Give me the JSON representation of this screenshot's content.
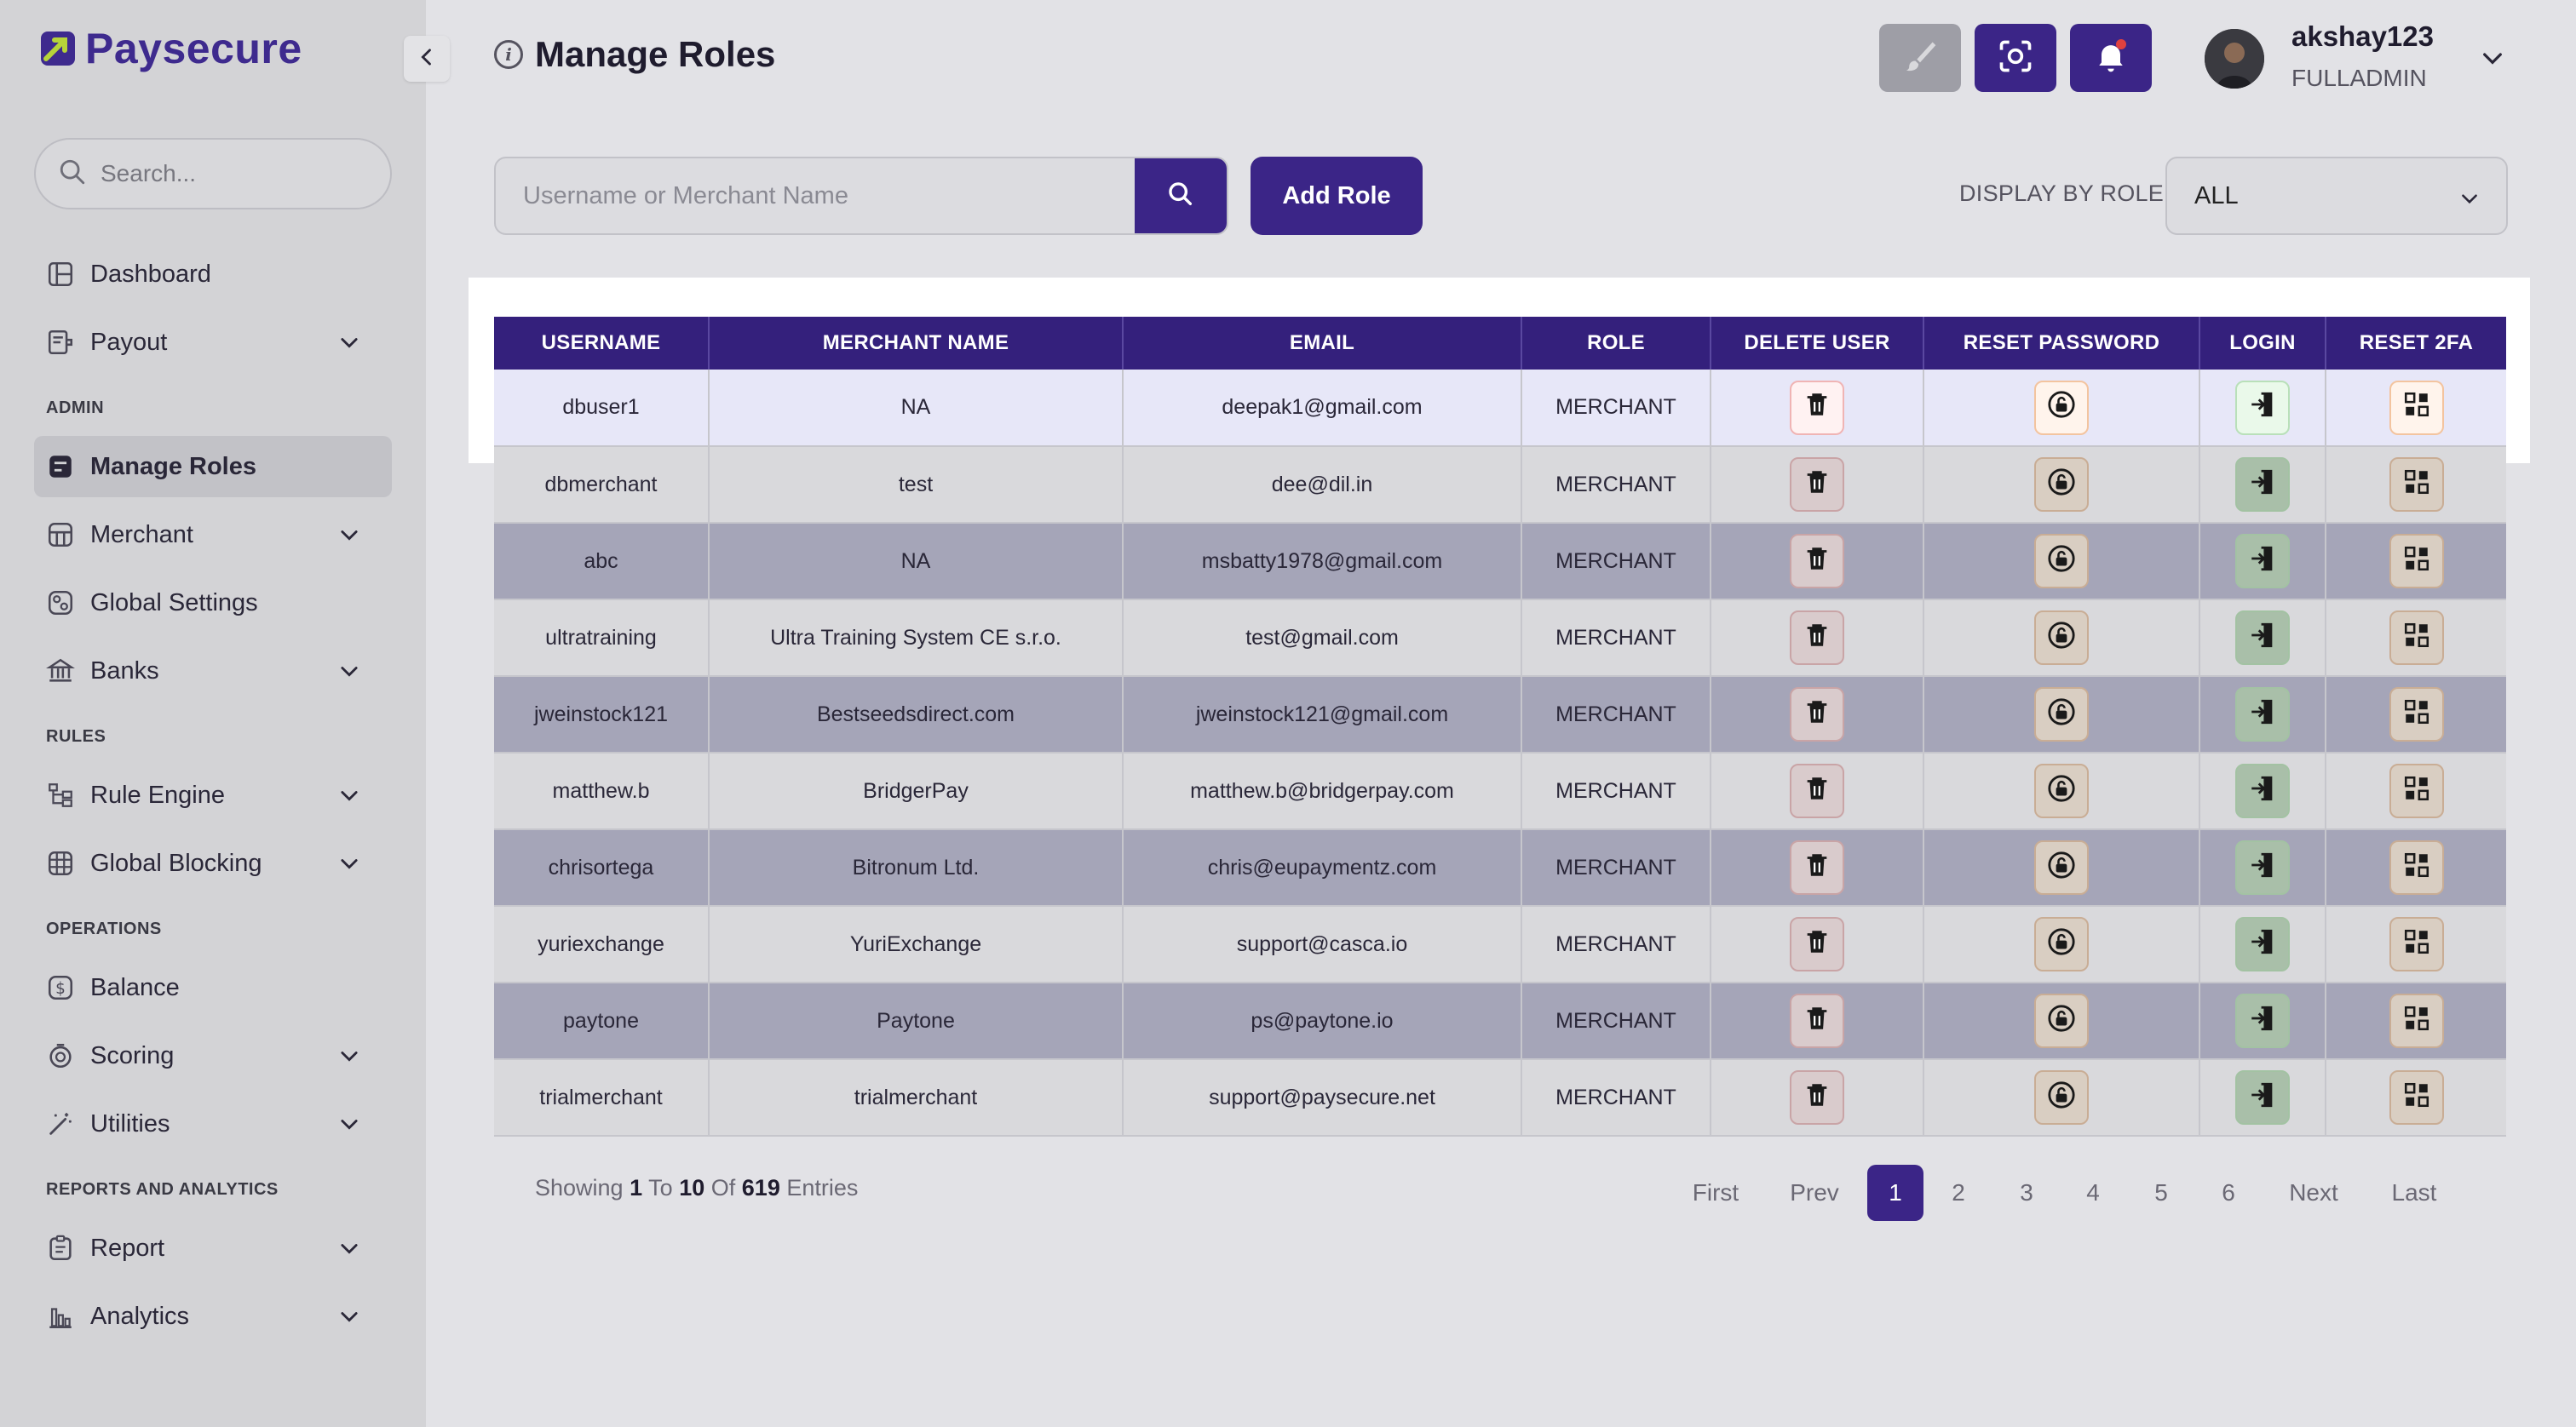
{
  "brand": {
    "name": "Paysecure"
  },
  "sidebar": {
    "search_placeholder": "Search...",
    "items": [
      {
        "label": "Dashboard",
        "icon": "dashboard-icon",
        "has_chevron": false
      },
      {
        "label": "Payout",
        "icon": "payout-icon",
        "has_chevron": true
      },
      {
        "label": "Manage Roles",
        "icon": "roles-icon",
        "has_chevron": false,
        "active": true
      },
      {
        "label": "Merchant",
        "icon": "merchant-icon",
        "has_chevron": true
      },
      {
        "label": "Global Settings",
        "icon": "settings-icon",
        "has_chevron": false
      },
      {
        "label": "Banks",
        "icon": "bank-icon",
        "has_chevron": true
      },
      {
        "label": "Rule Engine",
        "icon": "rule-engine-icon",
        "has_chevron": true
      },
      {
        "label": "Global Blocking",
        "icon": "blocking-icon",
        "has_chevron": true
      },
      {
        "label": "Balance",
        "icon": "dollar-icon",
        "has_chevron": false
      },
      {
        "label": "Scoring",
        "icon": "scoring-icon",
        "has_chevron": true
      },
      {
        "label": "Utilities",
        "icon": "wand-icon",
        "has_chevron": true
      },
      {
        "label": "Report",
        "icon": "report-icon",
        "has_chevron": true
      },
      {
        "label": "Analytics",
        "icon": "analytics-icon",
        "has_chevron": true
      }
    ],
    "sections": {
      "admin": "ADMIN",
      "rules": "RULES",
      "operations": "OPERATIONS",
      "reports": "REPORTS AND ANALYTICS"
    }
  },
  "header": {
    "title": "Manage Roles",
    "user_name": "akshay123",
    "user_role": "FULLADMIN"
  },
  "toolbar": {
    "search_placeholder": "Username or Merchant Name",
    "add_role_label": "Add Role",
    "display_by_role_label": "DISPLAY BY ROLE",
    "role_filter_value": "ALL"
  },
  "table": {
    "columns": [
      "USERNAME",
      "MERCHANT NAME",
      "EMAIL",
      "ROLE",
      "DELETE USER",
      "RESET PASSWORD",
      "LOGIN",
      "RESET 2FA"
    ],
    "rows": [
      {
        "username": "dbuser1",
        "merchant": "NA",
        "email": "deepak1@gmail.com",
        "role": "MERCHANT"
      },
      {
        "username": "dbmerchant",
        "merchant": "test",
        "email": "dee@dil.in",
        "role": "MERCHANT"
      },
      {
        "username": "abc",
        "merchant": "NA",
        "email": "msbatty1978@gmail.com",
        "role": "MERCHANT"
      },
      {
        "username": "ultratraining",
        "merchant": "Ultra Training System CE s.r.o.",
        "email": "test@gmail.com",
        "role": "MERCHANT"
      },
      {
        "username": "jweinstock121",
        "merchant": "Bestseedsdirect.com",
        "email": "jweinstock121@gmail.com",
        "role": "MERCHANT"
      },
      {
        "username": "matthew.b",
        "merchant": "BridgerPay",
        "email": "matthew.b@bridgerpay.com",
        "role": "MERCHANT"
      },
      {
        "username": "chrisortega",
        "merchant": "Bitronum Ltd.",
        "email": "chris@eupaymentz.com",
        "role": "MERCHANT"
      },
      {
        "username": "yuriexchange",
        "merchant": "YuriExchange",
        "email": "support@casca.io",
        "role": "MERCHANT"
      },
      {
        "username": "paytone",
        "merchant": "Paytone",
        "email": "ps@paytone.io",
        "role": "MERCHANT"
      },
      {
        "username": "trialmerchant",
        "merchant": "trialmerchant",
        "email": "support@paysecure.net",
        "role": "MERCHANT"
      }
    ]
  },
  "footer": {
    "showing_prefix": "Showing",
    "from": "1",
    "to_word": "To",
    "to": "10",
    "of_word": "Of",
    "total": "619",
    "entries_word": "Entries"
  },
  "pagination": {
    "first": "First",
    "prev": "Prev",
    "pages": [
      "1",
      "2",
      "3",
      "4",
      "5",
      "6"
    ],
    "current": "1",
    "next": "Next",
    "last": "Last"
  },
  "colors": {
    "brand_purple": "#3b2587",
    "header_purple": "#34207c"
  }
}
